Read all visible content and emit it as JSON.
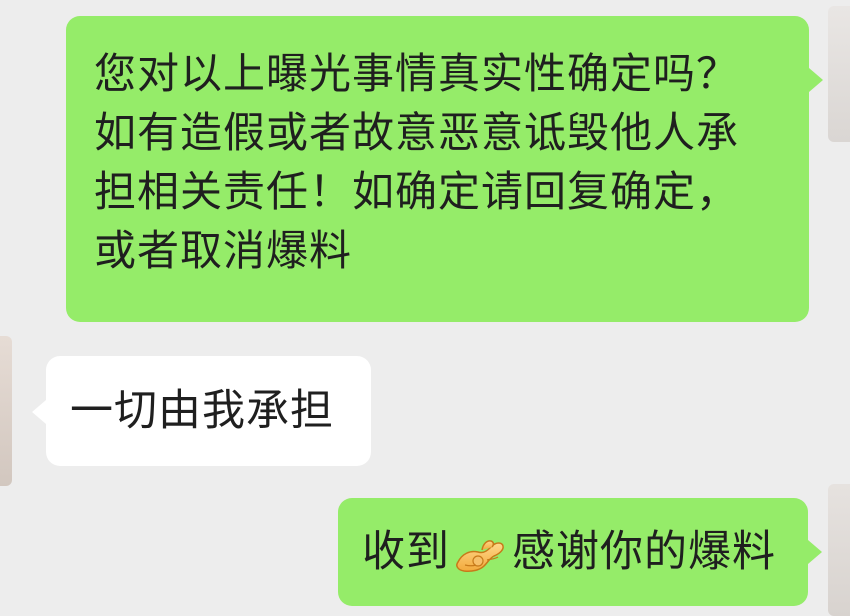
{
  "messages": [
    {
      "side": "right",
      "text": "您对以上曝光事情真实性确定吗？\n如有造假或者故意恶意诋毁他人承\n担相关责任！如确定请回复确定，\n或者取消爆料"
    },
    {
      "side": "left",
      "text": "一切由我承担"
    },
    {
      "side": "right",
      "text_before": "收到",
      "icon": "ok-hand-emoji-icon",
      "text_after": "感谢你的爆料"
    }
  ],
  "colors": {
    "background": "#ededed",
    "sent_bubble": "#95ec69",
    "received_bubble": "#ffffff",
    "text": "#1f1f1f"
  }
}
